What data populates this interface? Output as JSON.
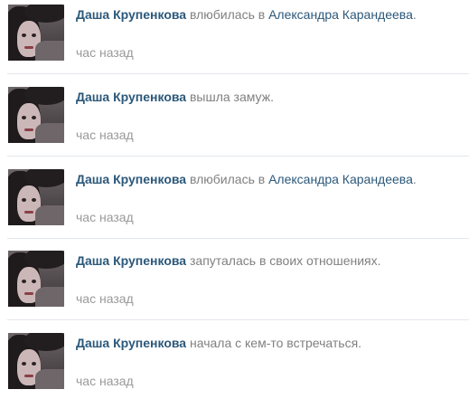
{
  "feed": {
    "items": [
      {
        "user": "Даша Крупенкова",
        "action": "влюбилась в",
        "target": "Александра Карандеева",
        "suffix": ".",
        "time": "час назад"
      },
      {
        "user": "Даша Крупенкова",
        "action": "вышла замуж.",
        "target": "",
        "suffix": "",
        "time": "час назад"
      },
      {
        "user": "Даша Крупенкова",
        "action": "влюбилась в",
        "target": "Александра Карандеева",
        "suffix": ".",
        "time": "час назад"
      },
      {
        "user": "Даша Крупенкова",
        "action": "запуталась в своих отношениях.",
        "target": "",
        "suffix": "",
        "time": "час назад"
      },
      {
        "user": "Даша Крупенкова",
        "action": "начала с кем-то встречаться.",
        "target": "",
        "suffix": "",
        "time": "час назад"
      }
    ]
  },
  "colors": {
    "link": "#2b587a",
    "text_muted": "#808080",
    "time": "#999999",
    "separator": "#e3e7ec"
  }
}
